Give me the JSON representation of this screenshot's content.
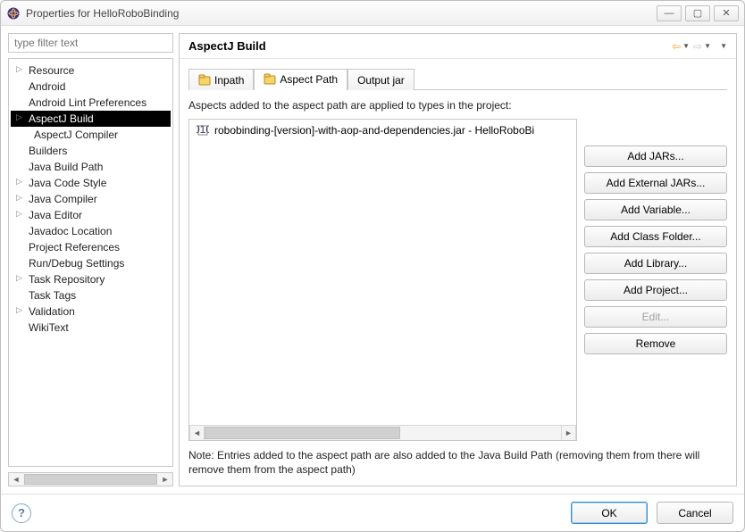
{
  "window": {
    "title": "Properties for HelloRoboBinding"
  },
  "sidebar": {
    "filter_placeholder": "type filter text",
    "items": [
      {
        "label": "Resource",
        "expandable": true
      },
      {
        "label": "Android"
      },
      {
        "label": "Android Lint Preferences"
      },
      {
        "label": "AspectJ Build",
        "expandable": true,
        "selected": true
      },
      {
        "label": "AspectJ Compiler",
        "child": true
      },
      {
        "label": "Builders"
      },
      {
        "label": "Java Build Path"
      },
      {
        "label": "Java Code Style",
        "expandable": true
      },
      {
        "label": "Java Compiler",
        "expandable": true
      },
      {
        "label": "Java Editor",
        "expandable": true
      },
      {
        "label": "Javadoc Location"
      },
      {
        "label": "Project References"
      },
      {
        "label": "Run/Debug Settings"
      },
      {
        "label": "Task Repository",
        "expandable": true
      },
      {
        "label": "Task Tags"
      },
      {
        "label": "Validation",
        "expandable": true
      },
      {
        "label": "WikiText"
      }
    ]
  },
  "main": {
    "title": "AspectJ Build",
    "tabs": [
      {
        "label": "Inpath",
        "icon": "inpath-icon"
      },
      {
        "label": "Aspect Path",
        "icon": "aspect-path-icon",
        "active": true
      },
      {
        "label": "Output jar",
        "icon": ""
      }
    ],
    "description": "Aspects added to the aspect path are applied to types in the project:",
    "entries": [
      {
        "label": "robobinding-[version]-with-aop-and-dependencies.jar - HelloRoboBi"
      }
    ],
    "buttons": {
      "add_jars": "Add JARs...",
      "add_external_jars": "Add External JARs...",
      "add_variable": "Add Variable...",
      "add_class_folder": "Add Class Folder...",
      "add_library": "Add Library...",
      "add_project": "Add Project...",
      "edit": "Edit...",
      "remove": "Remove"
    },
    "note": "Note: Entries added to the aspect path are also added to the Java Build Path (removing them from there will remove them from the aspect path)"
  },
  "footer": {
    "ok": "OK",
    "cancel": "Cancel"
  }
}
